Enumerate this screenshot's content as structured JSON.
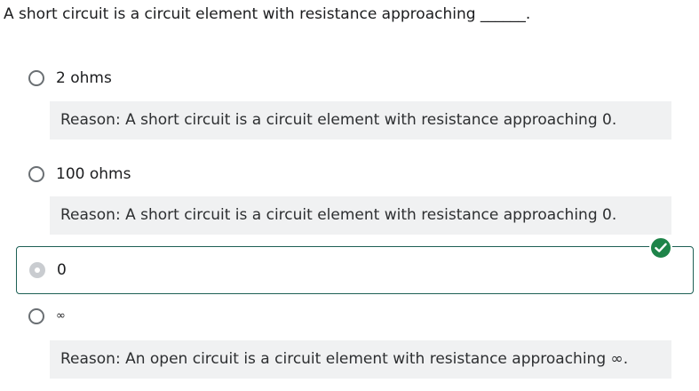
{
  "question": {
    "text": "A short circuit is a circuit element with resistance approaching ______."
  },
  "options": [
    {
      "label": "2 ohms",
      "selected": false,
      "reason": "Reason: A short circuit is a circuit element with resistance approaching 0."
    },
    {
      "label": "100 ohms",
      "selected": false,
      "reason": "Reason: A short circuit is a circuit element with resistance approaching 0."
    },
    {
      "label": "0",
      "selected": true,
      "correct": true
    },
    {
      "label": "∞",
      "selected": false,
      "reason": "Reason: An open circuit is a circuit element with resistance approaching ∞."
    }
  ],
  "colors": {
    "correct_border": "#1e6055",
    "correct_badge": "#1e8449",
    "reason_background": "#f0f1f2",
    "radio_border": "#6a6f73"
  },
  "icons": {
    "correct_badge": "check-circle-icon",
    "radio": "radio-icon"
  }
}
